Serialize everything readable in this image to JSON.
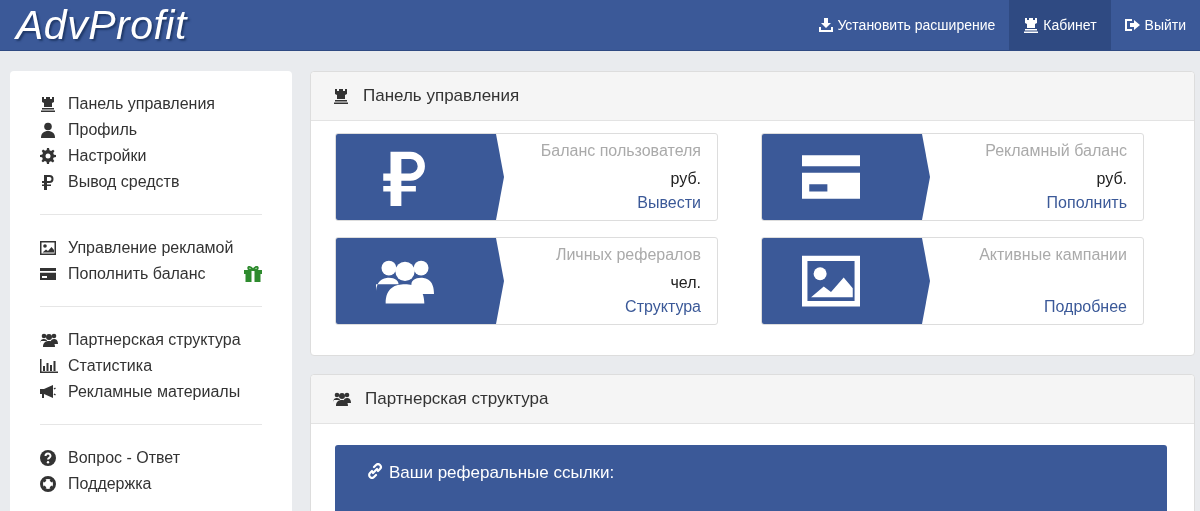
{
  "header": {
    "logo": "AdvProfit",
    "nav": [
      {
        "label": "Установить расширение",
        "selected": false
      },
      {
        "label": "Кабинет",
        "selected": true
      },
      {
        "label": "Выйти",
        "selected": false
      }
    ]
  },
  "sidebar": {
    "groups": [
      {
        "items": [
          {
            "label": "Панель управления",
            "bonus": false
          },
          {
            "label": "Профиль",
            "bonus": false
          },
          {
            "label": "Настройки",
            "bonus": false
          },
          {
            "label": "Вывод средств",
            "bonus": false
          }
        ]
      },
      {
        "items": [
          {
            "label": "Управление рекламой",
            "bonus": false
          },
          {
            "label": "Пополнить баланс",
            "bonus": true
          }
        ]
      },
      {
        "items": [
          {
            "label": "Партнерская структура",
            "bonus": false
          },
          {
            "label": "Статистика",
            "bonus": false
          },
          {
            "label": "Рекламные материалы",
            "bonus": false
          }
        ]
      },
      {
        "items": [
          {
            "label": "Вопрос - Ответ",
            "bonus": false
          },
          {
            "label": "Поддержка",
            "bonus": false
          }
        ]
      }
    ]
  },
  "dashboard": {
    "title": "Панель управления",
    "cards": [
      {
        "title": "Баланс пользователя",
        "unit": "руб.",
        "link": "Вывести"
      },
      {
        "title": "Рекламный баланс",
        "unit": "руб.",
        "link": "Пополнить"
      },
      {
        "title": "Личных рефералов",
        "unit": "чел.",
        "link": "Структура"
      },
      {
        "title": "Активные кампании",
        "link": "Подробнее"
      }
    ]
  },
  "partners": {
    "title": "Партнерская структура",
    "links_box": {
      "title": "Ваши реферальные ссылки:"
    }
  }
}
